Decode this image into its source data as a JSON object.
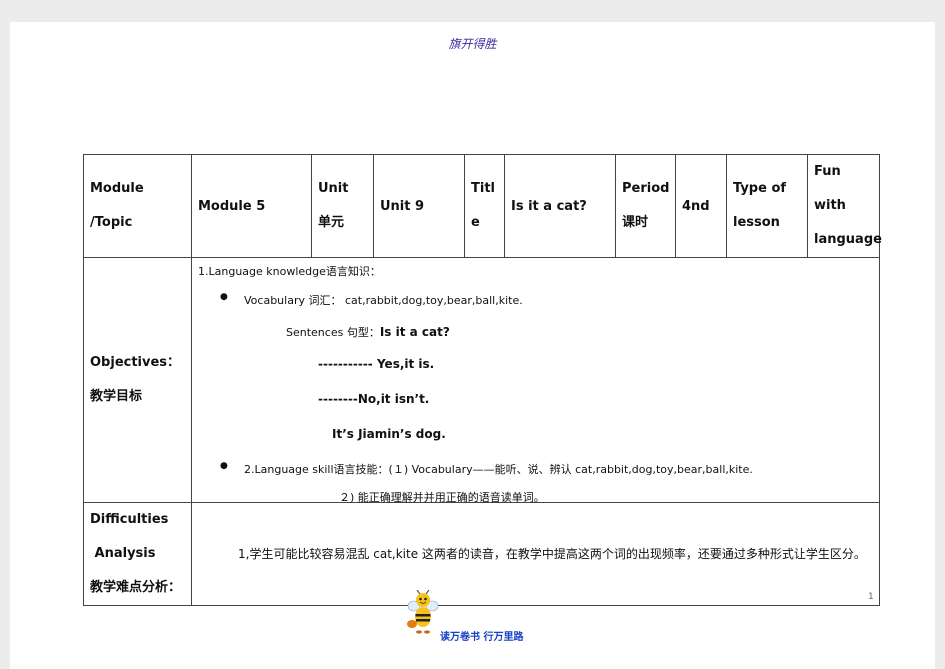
{
  "header": {
    "title": "旗开得胜"
  },
  "table": {
    "module_label_1": "Module",
    "module_label_2": "/Topic",
    "module_value": "Module 5",
    "unit_label_1": "Unit",
    "unit_label_2": "单元",
    "unit_value": "Unit 9",
    "title_label_1": "Titl",
    "title_label_2": "e",
    "title_value": "Is it a cat?",
    "period_label_1": "Period",
    "period_label_2": "课时",
    "period_value": "4nd",
    "type_label_1": "Type of",
    "type_label_2": "lesson",
    "type_value_1": "Fun with",
    "type_value_2": "language",
    "objectives_label_1": "Objectives：",
    "objectives_label_2": "教学目标",
    "obj_line1": "1.Language knowledge语言知识：",
    "obj_vocab": "Vocabulary 词汇： cat,rabbit,dog,toy,bear,ball,kite.",
    "obj_sent_prefix": "Sentences 句型：",
    "obj_sent_main": "Is it a cat?",
    "obj_yes": "----------- Yes,it is.",
    "obj_no": "--------No,it isn’t.",
    "obj_its": "It’s Jiamin’s dog.",
    "obj_skill": "2.Language skill语言技能：(１) Vocabulary——能听、说、辨认 cat,rabbit,dog,toy,bear,ball,kite.",
    "obj_skill2": "２) 能正确理解并并用正确的语音读单词。",
    "diff_label_1": "Difficulties",
    "diff_label_2": "Analysis",
    "diff_label_3": "教学难点分析：",
    "diff_text": "1,学生可能比较容易混乱 cat,kite 这两者的读音，在教学中提高这两个词的出现频率，还要通过多种形式让学生区分。"
  },
  "footer": {
    "page_number": "1",
    "slogan": "读万卷书 行万里路"
  }
}
